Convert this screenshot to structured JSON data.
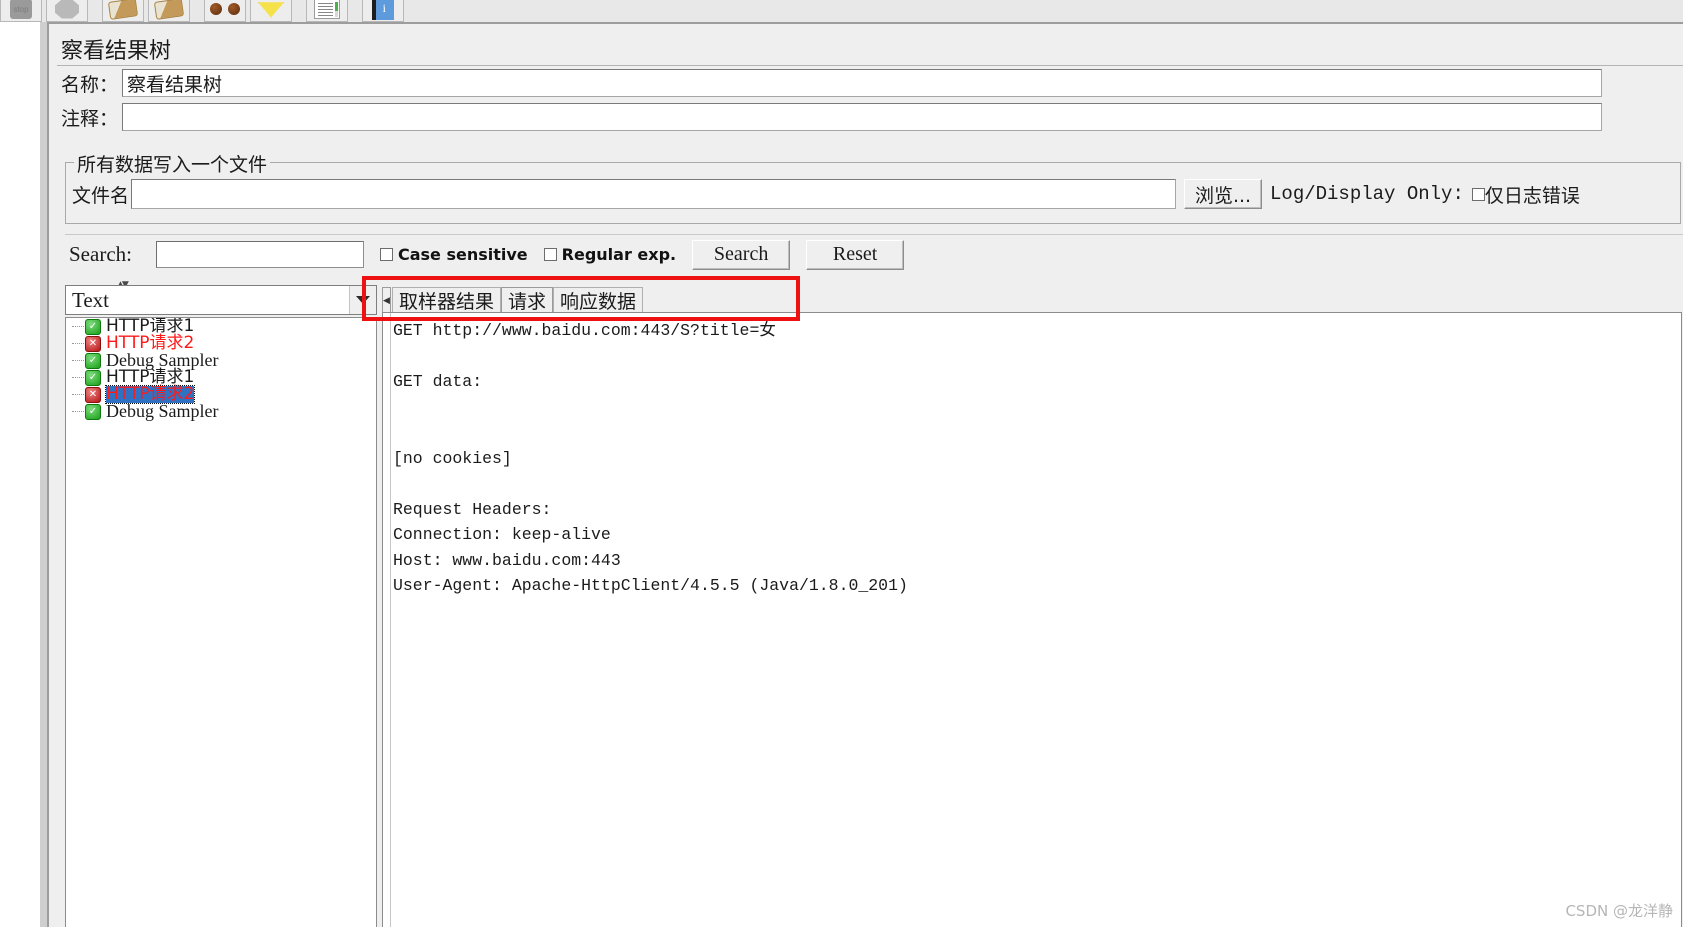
{
  "toolbar": {
    "buttons": [
      {
        "name": "stop-button",
        "icon": "stop-icon"
      },
      {
        "name": "shutdown-button",
        "icon": "octagon-icon"
      },
      {
        "name": "clear-button",
        "icon": "broom-icon"
      },
      {
        "name": "clear-all-button",
        "icon": "broom-all-icon"
      },
      {
        "name": "search-button",
        "icon": "glasses-icon"
      },
      {
        "name": "search-reset-button",
        "icon": "fan-icon"
      },
      {
        "name": "function-helper-button",
        "icon": "document-icon"
      },
      {
        "name": "help-button",
        "icon": "blue-book-icon"
      }
    ]
  },
  "panel": {
    "title": "察看结果树",
    "name_label": "名称：",
    "name_value": "察看结果树",
    "comment_label": "注释：",
    "comment_value": "",
    "group_title": "所有数据写入一个文件",
    "filename_label": "文件名",
    "filename_value": "",
    "browse_button": "浏览...",
    "log_display_label": "Log/Display Only:",
    "log_errors_only_label": "仅日志错误",
    "log_errors_only_checked": false
  },
  "search": {
    "label": "Search:",
    "value": "",
    "case_sensitive_label": "Case sensitive",
    "case_sensitive_checked": false,
    "regular_exp_label": "Regular exp.",
    "regular_exp_checked": false,
    "search_button": "Search",
    "reset_button": "Reset"
  },
  "renderer": {
    "selected": "Text"
  },
  "tree": {
    "items": [
      {
        "label": "HTTP请求1",
        "status": "ok",
        "selected": false
      },
      {
        "label": "HTTP请求2",
        "status": "error",
        "selected": false
      },
      {
        "label": "Debug Sampler",
        "status": "ok",
        "selected": false
      },
      {
        "label": "HTTP请求1",
        "status": "ok",
        "selected": false
      },
      {
        "label": "HTTP请求2",
        "status": "error",
        "selected": true
      },
      {
        "label": "Debug Sampler",
        "status": "ok",
        "selected": false
      }
    ]
  },
  "tabs": [
    {
      "label": "取样器结果",
      "active": false
    },
    {
      "label": "请求",
      "active": true
    },
    {
      "label": "响应数据",
      "active": false
    }
  ],
  "request_view": {
    "request_line": "GET http://www.baidu.com:443/S?title=女",
    "body": "GET data:\n\n\n[no cookies]\n\nRequest Headers:\nConnection: keep-alive\nHost: www.baidu.com:443\nUser-Agent: Apache-HttpClient/4.5.5 (Java/1.8.0_201)"
  },
  "watermark": "CSDN @龙洋静",
  "colors": {
    "accent_red": "#ee1111",
    "selection_blue": "#2f72c4",
    "error_text": "#ff1a1a",
    "panel_bg": "#efefef"
  }
}
